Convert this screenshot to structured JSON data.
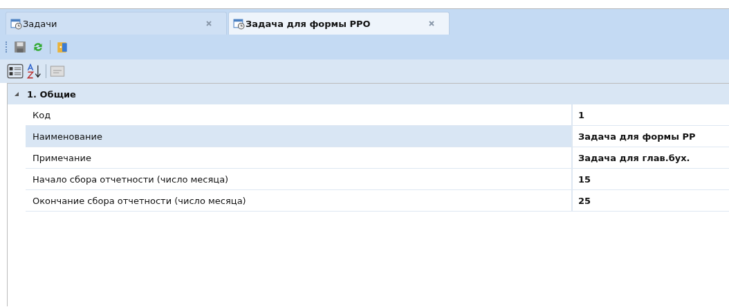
{
  "tabs": [
    {
      "label": "Задачи",
      "selected": false
    },
    {
      "label": "Задача для формы РРО",
      "selected": true
    }
  ],
  "grid": {
    "category": {
      "label": "1. Общие",
      "expanded": true
    },
    "rows": [
      {
        "name": "Код",
        "value": "1",
        "selected": false
      },
      {
        "name": "Наименование",
        "value": "Задача для формы РР",
        "selected": true
      },
      {
        "name": "Примечание",
        "value": "Задача для глав.бух.",
        "selected": false
      },
      {
        "name": "Начало сбора отчетности (число месяца)",
        "value": "15",
        "selected": false
      },
      {
        "name": "Окончание сбора отчетности (число месяца)",
        "value": "25",
        "selected": false
      }
    ]
  }
}
